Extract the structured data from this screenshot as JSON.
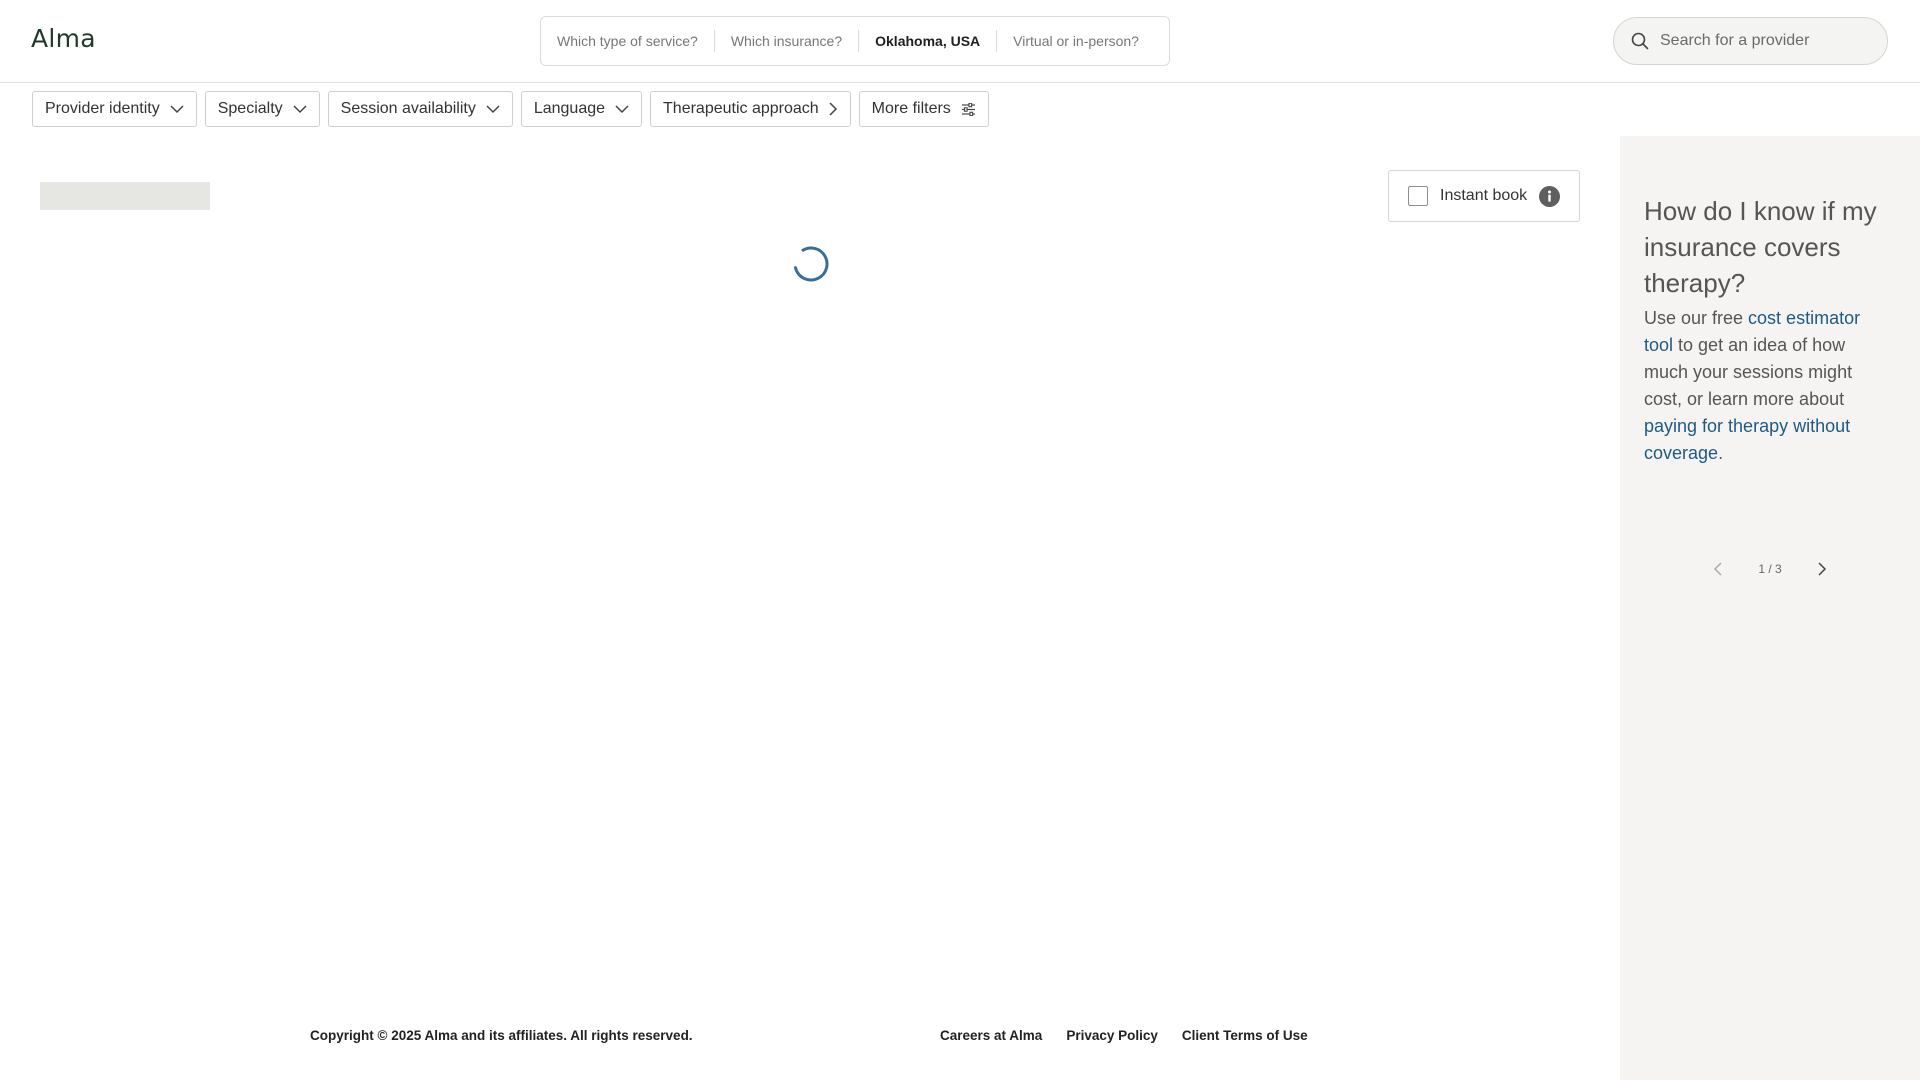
{
  "header": {
    "logo": "Alma",
    "segments": [
      {
        "label": "Which type of service?",
        "active": false
      },
      {
        "label": "Which insurance?",
        "active": false
      },
      {
        "label": "Oklahoma, USA",
        "active": true
      },
      {
        "label": "Virtual or in-person?",
        "active": false
      }
    ],
    "search": {
      "placeholder": "Search for a provider",
      "value": ""
    }
  },
  "filters": [
    {
      "label": "Provider identity",
      "icon": "chevron-down-icon"
    },
    {
      "label": "Specialty",
      "icon": "chevron-down-icon"
    },
    {
      "label": "Session availability",
      "icon": "chevron-down-icon"
    },
    {
      "label": "Language",
      "icon": "chevron-down-icon"
    },
    {
      "label": "Therapeutic approach",
      "icon": "chevron-right-icon"
    },
    {
      "label": "More filters",
      "icon": "sliders-icon"
    }
  ],
  "main": {
    "instant_book": {
      "label": "Instant book",
      "checked": false
    },
    "loading": true
  },
  "sidebar": {
    "title": "How do I know if my insurance covers therapy?",
    "body": {
      "part1": "Use our free ",
      "link1": "cost estimator tool",
      "part2": " to get an idea of how much your sessions might cost, or learn more about ",
      "link2": "paying for therapy without coverage",
      "part3": "."
    },
    "pager": "1 / 3"
  },
  "footer": {
    "copyright": "Copyright © 2025 Alma and its affiliates. All rights reserved.",
    "links": [
      "Careers at Alma",
      "Privacy Policy",
      "Client Terms of Use"
    ]
  },
  "colors": {
    "brand": "#1f3a2c",
    "link": "#1f5a85",
    "spinner": "#3a6d9a",
    "sidebar_bg": "#f5f4f2"
  }
}
